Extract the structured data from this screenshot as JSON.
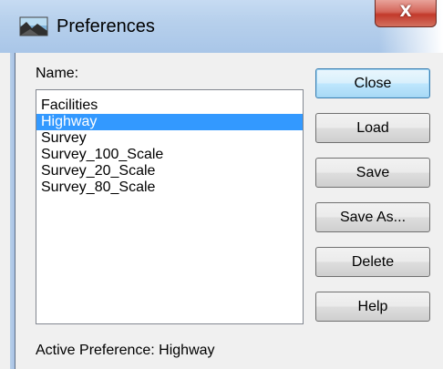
{
  "window": {
    "title": "Preferences",
    "close_glyph": "X",
    "icon": "preferences-app-icon"
  },
  "list": {
    "label": "Name:",
    "items": [
      "Facilities",
      "Highway",
      "Survey",
      "Survey_100_Scale",
      "Survey_20_Scale",
      "Survey_80_Scale"
    ],
    "selected": "Highway"
  },
  "buttons": {
    "close": "Close",
    "load": "Load",
    "save": "Save",
    "save_as": "Save As...",
    "delete": "Delete",
    "help": "Help"
  },
  "status": {
    "active_preference": "Active Preference: Highway"
  },
  "colors": {
    "selection": "#3399ff",
    "titlebar": "#b7d0ec",
    "close_button": "#c2392b"
  }
}
